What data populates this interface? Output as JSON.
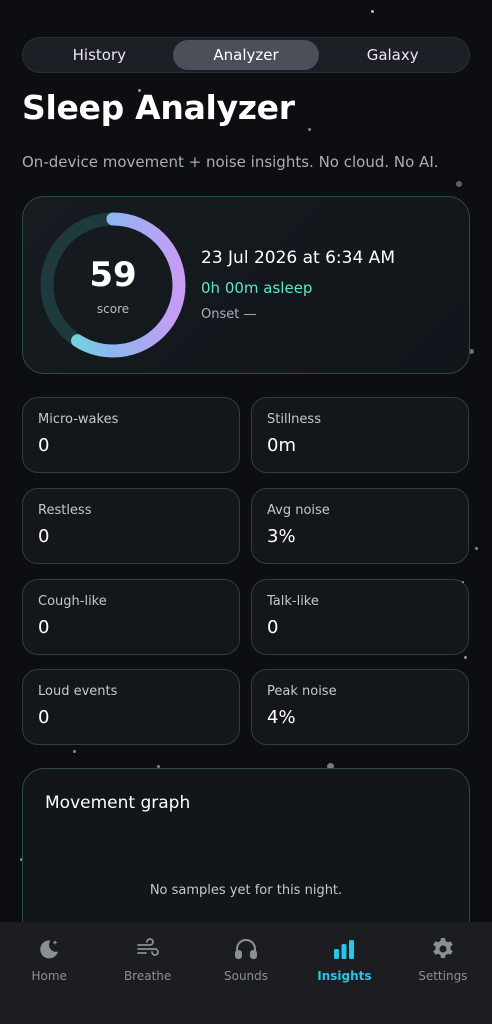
{
  "tabs": [
    {
      "label": "History",
      "active": false
    },
    {
      "label": "Analyzer",
      "active": true
    },
    {
      "label": "Galaxy",
      "active": false
    }
  ],
  "page": {
    "title": "Sleep Analyzer",
    "subtitle": "On-device movement + noise insights. No cloud. No AI."
  },
  "score_card": {
    "score": "59",
    "score_label": "score",
    "score_fraction": 0.59,
    "date": "23 Jul 2026 at 6:34 AM",
    "asleep": "0h 00m asleep",
    "onset": "Onset —"
  },
  "stats": [
    {
      "label": "Micro-wakes",
      "value": "0"
    },
    {
      "label": "Stillness",
      "value": "0m"
    },
    {
      "label": "Restless",
      "value": "0"
    },
    {
      "label": "Avg noise",
      "value": "3%"
    },
    {
      "label": "Cough-like",
      "value": "0"
    },
    {
      "label": "Talk-like",
      "value": "0"
    },
    {
      "label": "Loud events",
      "value": "0"
    },
    {
      "label": "Peak noise",
      "value": "4%"
    }
  ],
  "movement_graph": {
    "title": "Movement graph",
    "empty_text": "No samples yet for this night."
  },
  "nav": [
    {
      "label": "Home",
      "icon": "moon-icon",
      "active": false
    },
    {
      "label": "Breathe",
      "icon": "wind-icon",
      "active": false
    },
    {
      "label": "Sounds",
      "icon": "headphones-icon",
      "active": false
    },
    {
      "label": "Insights",
      "icon": "bar-chart-icon",
      "active": true
    },
    {
      "label": "Settings",
      "icon": "gear-icon",
      "active": false
    }
  ],
  "colors": {
    "accent": "#26c6e8",
    "asleep_green": "#62e3c7",
    "ring_start": "#5ee6cf",
    "ring_end": "#c79cf5"
  }
}
